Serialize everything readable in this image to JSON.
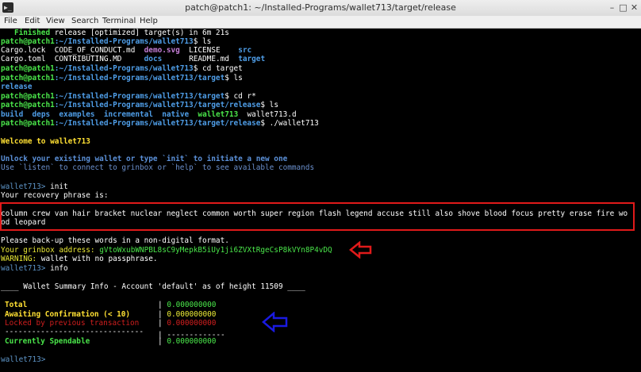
{
  "window": {
    "title": "patch@patch1: ~/Installed-Programs/wallet713/target/release",
    "icon_glyph": "▶_",
    "minimize_glyph": "–",
    "maximize_glyph": "□",
    "close_glyph": "✕"
  },
  "menu": [
    "File",
    "Edit",
    "View",
    "Search",
    "Terminal",
    "Help"
  ],
  "terminal": {
    "finished_word": "Finished",
    "finished_rest": " release [optimized] target(s) in 6m 21s",
    "prompt_user": "patch@patch1",
    "path_home": ":~/Installed-Programs/wallet713",
    "path_target": ":~/Installed-Programs/wallet713/target",
    "path_release": ":~/Installed-Programs/wallet713/target/release",
    "cmd_ls": "ls",
    "cmd_cd_target": "cd target",
    "cmd_cd_r": "cd r*",
    "cmd_run": "./wallet713",
    "ls1": [
      "Cargo.lock",
      "CODE_OF_CONDUCT.md",
      "demo.svg",
      "LICENSE",
      "src"
    ],
    "ls2": [
      "Cargo.toml",
      "CONTRIBUTING.MD",
      "docs",
      "README.md",
      "target"
    ],
    "ls3": "release",
    "ls4": [
      "build",
      "deps",
      "examples",
      "incremental",
      "native",
      "wallet713",
      "wallet713.d"
    ],
    "welcome": "Welcome to wallet713",
    "unlock": "Unlock your existing wallet or type `init` to initiate a new one",
    "use_listen": "Use `listen` to connect to grinbox or `help` to see available commands",
    "wallet_prompt": "wallet713>",
    "cmd_init": "init",
    "recovery_label": "Your recovery phrase is:",
    "recovery_line1": "column crew van hair bracket nuclear neglect common worth super region flash legend accuse still also shove blood focus pretty erase fire wo",
    "recovery_line2": "od leopard",
    "backup": "Please back-up these words in a non-digital format.",
    "grinbox_label": "Your grinbox address:",
    "grinbox_address": "gVtoWxubWNPBL8sC9yMepkB5iUy1ji6ZVXtRgeCsP8kVYn8P4vDQ",
    "warning_label": "WARNING:",
    "warning_text": " wallet with no passphrase.",
    "cmd_info": "info",
    "summary_header": "____ Wallet Summary Info - Account 'default' as of height 11509 ____",
    "summary": [
      {
        "label": "Total",
        "value": "0.000000000"
      },
      {
        "label": "Awaiting Confirmation (< 10)",
        "value": "0.000000000"
      },
      {
        "label": "Locked by previous transaction",
        "value": "0.000000000"
      },
      {
        "label": "Currently Spendable",
        "value": "0.000000000"
      }
    ],
    "separator_left": "-------------------------------",
    "separator_right": "-------------",
    "pipe": "|"
  },
  "annotations": {
    "box_color": "#e01a1a",
    "arrow_red_color": "#e01a1a",
    "arrow_blue_color": "#1a1ae0"
  }
}
